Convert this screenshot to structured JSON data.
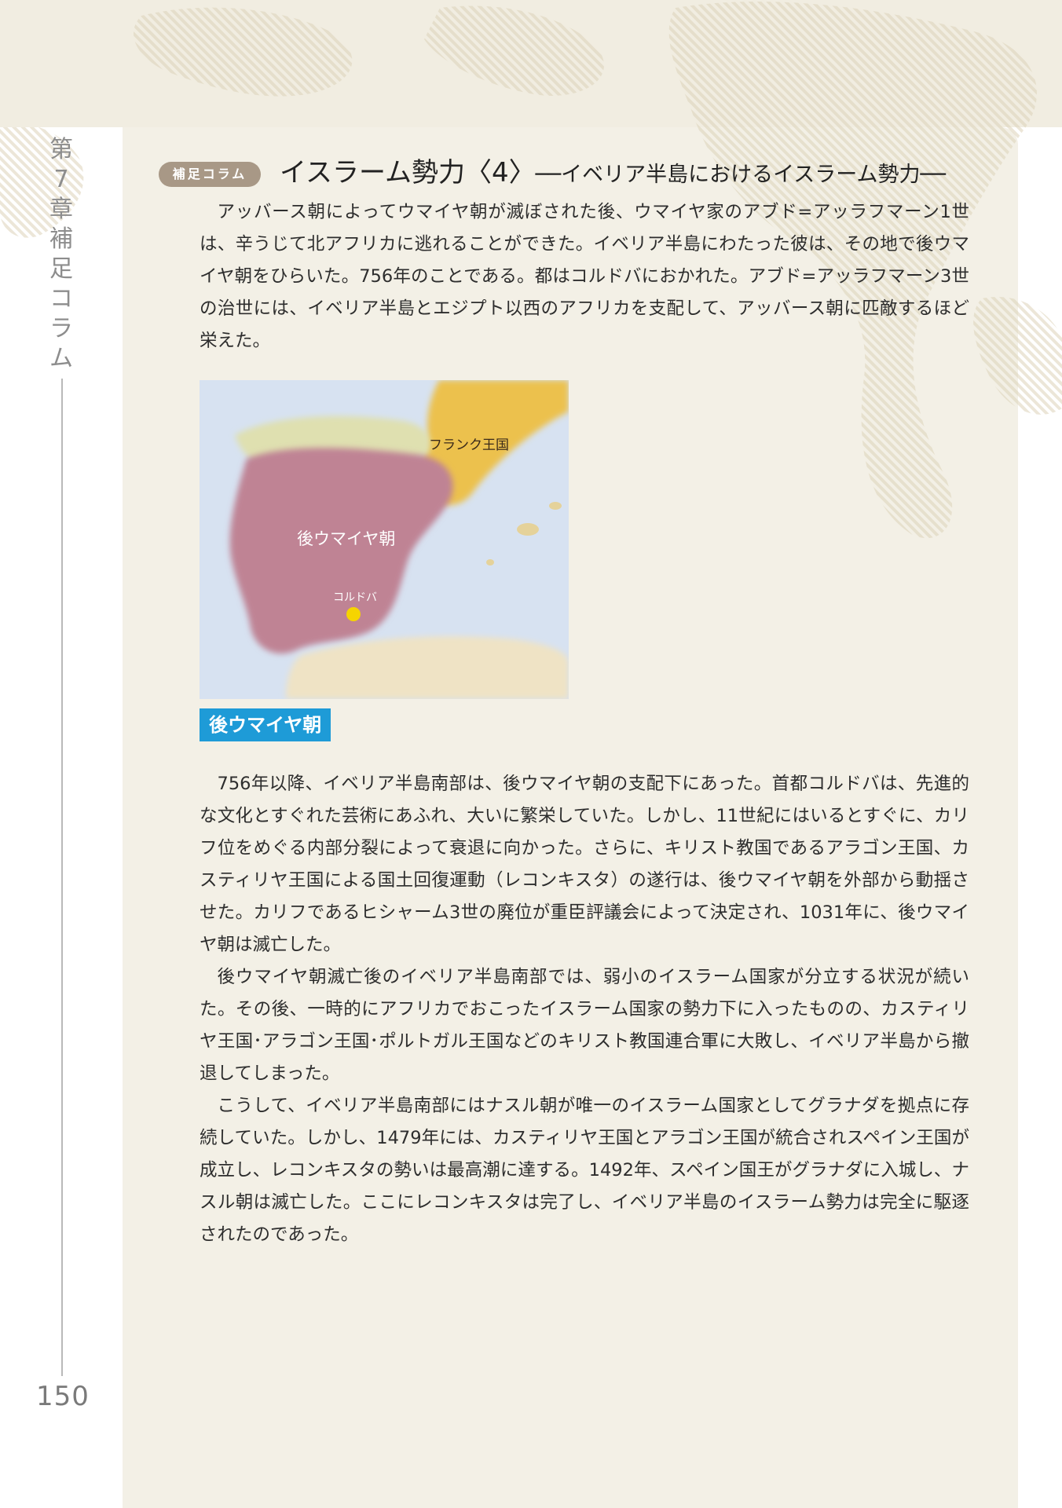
{
  "sidebar": {
    "chapter_chars": [
      "第",
      "7",
      "章",
      "補",
      "足",
      "コ",
      "ラ",
      "ム"
    ],
    "page_number": "150"
  },
  "column": {
    "badge": "補足コラム",
    "title": "イスラーム勢力〈4〉",
    "subtitle": "──イベリア半島におけるイスラーム勢力──"
  },
  "intro_paragraph": "アッバース朝によってウマイヤ朝が滅ぼされた後、ウマイヤ家のアブド=アッラフマーン1世は、辛うじて北アフリカに逃れることができた。イベリア半島にわたった彼は、その地で後ウマイヤ朝をひらいた。756年のことである。都はコルドバにおかれた。アブド=アッラフマーン3世の治世には、イベリア半島とエジプト以西のアフリカを支配して、アッバース朝に匹敵するほど栄えた。",
  "map": {
    "label_frank": "フランク王国",
    "label_umayyad": "後ウマイヤ朝",
    "label_cordoba": "コルドバ",
    "caption": "後ウマイヤ朝",
    "colors": {
      "sea": "#d7e2f1",
      "umayyad": "#bf8394",
      "frank": "#ecc14d",
      "north": "#dfe0b0",
      "africa": "#efe3c5",
      "cordoba": "#f6d400"
    }
  },
  "body_paragraphs": [
    "756年以降、イベリア半島南部は、後ウマイヤ朝の支配下にあった。首都コルドバは、先進的な文化とすぐれた芸術にあふれ、大いに繁栄していた。しかし、11世紀にはいるとすぐに、カリフ位をめぐる内部分裂によって衰退に向かった。さらに、キリスト教国であるアラゴン王国、カスティリヤ王国による国土回復運動（レコンキスタ）の遂行は、後ウマイヤ朝を外部から動揺させた。カリフであるヒシャーム3世の廃位が重臣評議会によって決定され、1031年に、後ウマイヤ朝は滅亡した。",
    "後ウマイヤ朝滅亡後のイベリア半島南部では、弱小のイスラーム国家が分立する状況が続いた。その後、一時的にアフリカでおこったイスラーム国家の勢力下に入ったものの、カスティリヤ王国･アラゴン王国･ポルトガル王国などのキリスト教国連合軍に大敗し、イベリア半島から撤退してしまった。",
    "こうして、イベリア半島南部にはナスル朝が唯一のイスラーム国家としてグラナダを拠点に存続していた。しかし、1479年には、カスティリヤ王国とアラゴン王国が統合されスペイン王国が成立し、レコンキスタの勢いは最高潮に達する。1492年、スペイン国王がグラナダに入城し、ナスル朝は滅亡した。ここにレコンキスタは完了し、イベリア半島のイスラーム勢力は完全に駆逐されたのであった。"
  ]
}
